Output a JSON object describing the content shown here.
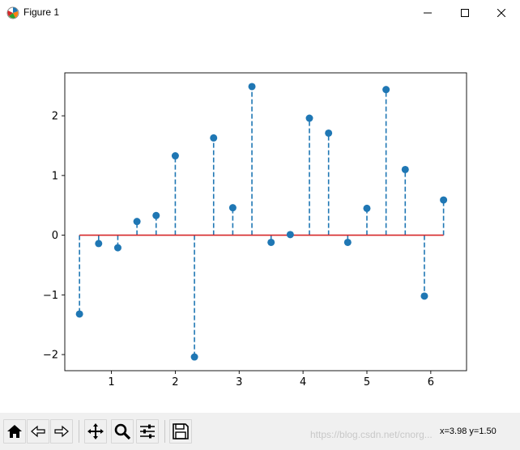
{
  "window": {
    "title": "Figure 1"
  },
  "status": {
    "coords": "x=3.98 y=1.50",
    "watermark": "https://blog.csdn.net/cnorg..."
  },
  "toolbar": {
    "tools": [
      "home-icon",
      "back-icon",
      "forward-icon",
      "pan-icon",
      "zoom-icon",
      "configure-icon",
      "save-icon"
    ]
  },
  "chart_data": {
    "type": "stem",
    "title": "",
    "xlabel": "",
    "ylabel": "",
    "xlim": [
      0.27,
      6.56
    ],
    "ylim": [
      -2.27,
      2.72
    ],
    "xticks": [
      1,
      2,
      3,
      4,
      5,
      6
    ],
    "yticks": [
      -2,
      -1,
      0,
      1,
      2
    ],
    "xtick_labels": [
      "1",
      "2",
      "3",
      "4",
      "5",
      "6"
    ],
    "ytick_labels": [
      "−2",
      "−1",
      "0",
      "1",
      "2"
    ],
    "baseline": 0,
    "colors": {
      "stem": "#1f77b4",
      "marker": "#1f77b4",
      "baseline": "#d62728"
    },
    "x": [
      0.5,
      0.8,
      1.1,
      1.4,
      1.7,
      2.0,
      2.3,
      2.6,
      2.9,
      3.2,
      3.5,
      3.8,
      4.1,
      4.4,
      4.7,
      5.0,
      5.3,
      5.6,
      5.9,
      6.2
    ],
    "y": [
      -1.32,
      -0.14,
      -0.21,
      0.23,
      0.33,
      1.33,
      -2.04,
      1.63,
      0.46,
      2.49,
      -0.12,
      0.01,
      1.96,
      1.71,
      -0.12,
      0.45,
      2.44,
      1.1,
      -1.02,
      0.59
    ]
  }
}
